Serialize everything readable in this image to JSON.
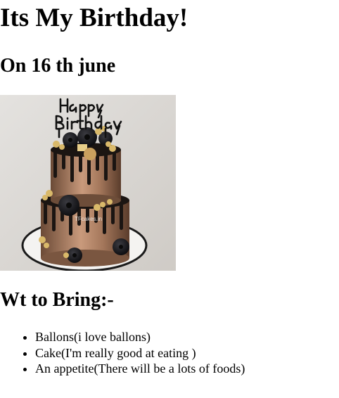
{
  "page": {
    "title": "Its My Birthday!",
    "date_heading": "On 16 th june",
    "bring_heading": "Wt to Bring:-"
  },
  "image": {
    "description": "two-tier chocolate drip cake with donuts and a Happy Birthday topper",
    "topper_text_line1": "Happy",
    "topper_text_line2": "Birthday",
    "watermark": "TFcakes.in"
  },
  "bring_list": {
    "items": [
      "Ballons(i love ballons)",
      "Cake(I'm really good at eating )",
      "An appetite(There will be a lots of foods)"
    ]
  }
}
